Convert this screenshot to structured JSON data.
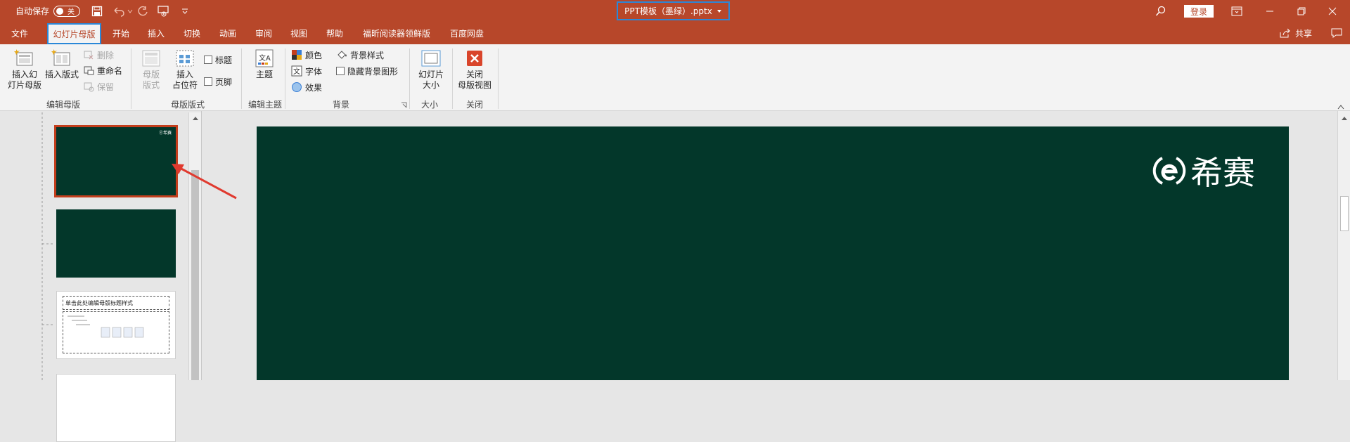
{
  "titlebar": {
    "autosave_label": "自动保存",
    "autosave_state": "关",
    "doc_title": "PPT模板（墨绿）.pptx",
    "login_label": "登录"
  },
  "tabs": [
    "文件",
    "幻灯片母版",
    "开始",
    "插入",
    "切换",
    "动画",
    "审阅",
    "视图",
    "帮助",
    "福昕阅读器领鲜版",
    "百度网盘"
  ],
  "share_label": "共享",
  "ribbon": {
    "insert_master": [
      "插入幻",
      "灯片母版"
    ],
    "insert_layout": "插入版式",
    "delete": "删除",
    "rename": "重命名",
    "preserve": "保留",
    "group_edit_master": "编辑母版",
    "master_layout": [
      "母版",
      "版式"
    ],
    "insert_placeholder": [
      "插入",
      "占位符"
    ],
    "title_chk": "标题",
    "footer_chk": "页脚",
    "group_master_layout": "母版版式",
    "theme": "主题",
    "group_edit_theme": "编辑主题",
    "colors": "颜色",
    "fonts": "字体",
    "effects": "效果",
    "bg_styles": "背景样式",
    "hide_bg": "隐藏背景图形",
    "group_background": "背景",
    "slide_size": [
      "幻灯片",
      "大小"
    ],
    "group_size": "大小",
    "close_view": [
      "关闭",
      "母版视图"
    ],
    "group_close": "关闭"
  },
  "thumbs": {
    "tiny_logo": "ⓔ希赛",
    "layout_title": "单击此处编辑母版标题样式"
  },
  "slide": {
    "logo_text": "希赛"
  },
  "colors": {
    "brand": "#b7472a",
    "slide_bg": "#03372a",
    "highlight": "#2b88d8",
    "arrow": "#e03a2f"
  }
}
